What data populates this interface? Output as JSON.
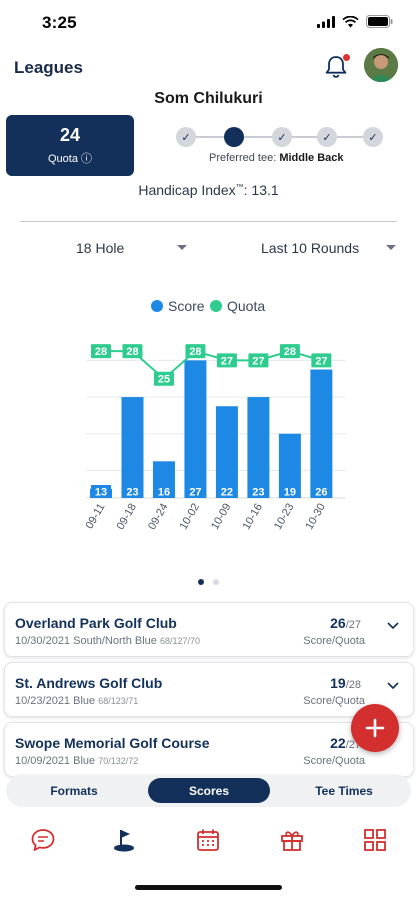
{
  "status": {
    "time": "3:25"
  },
  "header": {
    "title": "Leagues"
  },
  "player": {
    "name": "Som Chilukuri"
  },
  "quota": {
    "value": "24",
    "label": "Quota ⓘ"
  },
  "tee": {
    "label": "Preferred tee:",
    "value": "Middle Back",
    "selected_index": 1,
    "count": 5
  },
  "handicap": {
    "label": "Handicap Index",
    "tm": "™",
    "value": ": 13.1"
  },
  "filters": {
    "holes": "18 Hole",
    "range": "Last 10 Rounds"
  },
  "legend": [
    {
      "name": "Score",
      "color": "#1e88e5"
    },
    {
      "name": "Quota",
      "color": "#2ecc8f"
    }
  ],
  "chart_data": {
    "type": "bar",
    "categories": [
      "09-11",
      "09-18",
      "09-24",
      "10-02",
      "10-09",
      "10-16",
      "10-23",
      "10-30"
    ],
    "series": [
      {
        "name": "Score",
        "type": "bar",
        "color": "#1e88e5",
        "values": [
          13,
          23,
          16,
          27,
          22,
          23,
          19,
          26
        ]
      },
      {
        "name": "Quota",
        "type": "line",
        "color": "#2ecc8f",
        "values": [
          28,
          28,
          25,
          28,
          27,
          27,
          28,
          27
        ]
      }
    ],
    "ylim": [
      12,
      29
    ],
    "grid": true,
    "legend_position": "top-center"
  },
  "pager": {
    "count": 2,
    "active": 0
  },
  "rounds": [
    {
      "course": "Overland Park Golf Club",
      "date": "10/30/2021",
      "tee": "South/North Blue",
      "slope": "68/127/70",
      "score": "26",
      "quota": "/27",
      "sub": "Score/Quota"
    },
    {
      "course": "St. Andrews Golf Club",
      "date": "10/23/2021",
      "tee": "Blue",
      "slope": "68/123/71",
      "score": "19",
      "quota": "/28",
      "sub": "Score/Quota"
    },
    {
      "course": "Swope Memorial Golf Course",
      "date": "10/09/2021",
      "tee": "Blue",
      "slope": "70/132/72",
      "score": "22",
      "quota": "/27",
      "sub": "Score/Quota"
    }
  ],
  "segments": {
    "formats": "Formats",
    "scores": "Scores",
    "tee_times": "Tee Times",
    "active": "scores"
  },
  "tabs": [
    "chat-icon",
    "golf-flag-icon",
    "calendar-icon",
    "gift-icon",
    "grid-icon"
  ],
  "colors": {
    "navy": "#12305a",
    "accent_red": "#d32f2f",
    "score_blue": "#1e88e5",
    "quota_green": "#2ecc8f"
  }
}
